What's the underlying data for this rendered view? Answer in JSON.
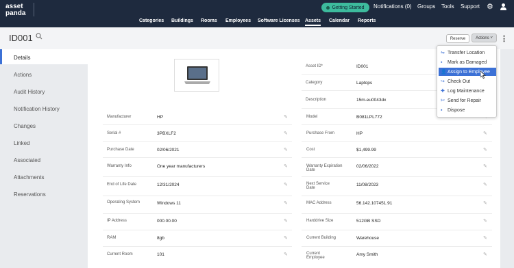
{
  "brand": {
    "line1": "asset",
    "line2": "panda"
  },
  "topbar": {
    "getting_started": "Getting Started",
    "notifications": "Notifications (0)",
    "groups": "Groups",
    "tools": "Tools",
    "support": "Support"
  },
  "nav": [
    "Categories",
    "Buildings",
    "Rooms",
    "Employees",
    "Software Licenses",
    "Assets",
    "Calendar",
    "Reports"
  ],
  "nav_active": "Assets",
  "asset_title": "ID001",
  "buttons": {
    "reserve": "Reserve",
    "actions": "Actions ˅"
  },
  "sidebar": [
    "Details",
    "Actions",
    "Audit History",
    "Notification History",
    "Changes",
    "Linked",
    "Associated",
    "Attachments",
    "Reservations"
  ],
  "sidebar_active": "Details",
  "top_right_fields": [
    {
      "label": "Asset ID*",
      "value": "ID001"
    },
    {
      "label": "Category",
      "value": "Laptops"
    },
    {
      "label": "Description",
      "value": "15m-eu0043dx"
    }
  ],
  "left_fields": [
    {
      "label": "Manufacturer",
      "value": "HP"
    },
    {
      "label": "Serial #",
      "value": "3PBXLF2"
    },
    {
      "label": "Purchase Date",
      "value": "02/06/2021"
    },
    {
      "label": "Warranty Info",
      "value": "One year manufacturers"
    },
    {
      "label": "End of Life Date",
      "value": "12/31/2024"
    },
    {
      "label": "Operating System",
      "value": "Windows 11"
    },
    {
      "label": "IP Address",
      "value": "000.00.00"
    },
    {
      "label": "RAM",
      "value": "8gb"
    },
    {
      "label": "Current Room",
      "value": "101"
    }
  ],
  "right_fields": [
    {
      "label": "Model",
      "value": "B081LPL772"
    },
    {
      "label": "Purchase From",
      "value": "HP"
    },
    {
      "label": "Cost",
      "value": "$1,499.99"
    },
    {
      "label": "Warranty Expiration Date",
      "value": "02/06/2022"
    },
    {
      "label": "Next Service Date",
      "value": "11/08/2023"
    },
    {
      "label": "MAC Address",
      "value": "56.142.107451.91"
    },
    {
      "label": "Harddrive Size",
      "value": "512GB SSD"
    },
    {
      "label": "Current Building",
      "value": "Warehouse"
    },
    {
      "label": "Current Employee",
      "value": "Amy Smith"
    }
  ],
  "actions_menu": [
    {
      "label": "Transfer Location",
      "icon": "transfer-icon"
    },
    {
      "label": "Mark as Damaged",
      "icon": "trash-icon"
    },
    {
      "label": "Assign to Employee",
      "icon": "user-icon",
      "highlighted": true
    },
    {
      "label": "Check Out",
      "icon": "checkout-icon"
    },
    {
      "label": "Log Maintenance",
      "icon": "plus-icon"
    },
    {
      "label": "Send for Repair",
      "icon": "wrench-icon"
    },
    {
      "label": "Dispose",
      "icon": "trash-icon"
    }
  ],
  "colors": {
    "topbar": "#1e2a3e",
    "accent": "#3c71d6",
    "pill": "#3dbb9d"
  }
}
